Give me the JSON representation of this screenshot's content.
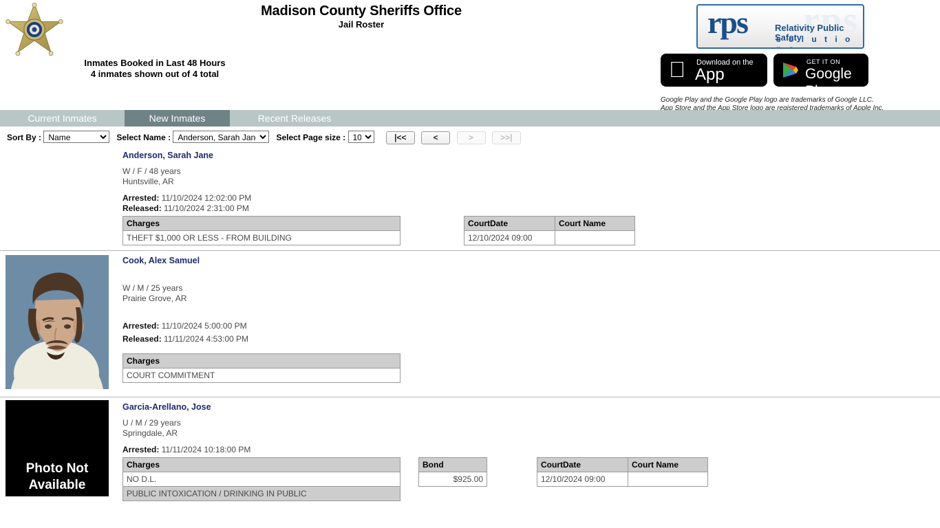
{
  "header": {
    "badge_icon": "sheriff-star-badge-icon",
    "title": "Madison County Sheriffs Office",
    "subtitle": "Jail Roster",
    "booked_heading": "Inmates Booked in Last 48 Hours",
    "booked_count": "4 inmates shown out of 4 total",
    "logo": {
      "mark": "rps",
      "ghost": "rps",
      "line1": "Relativity Public Safety",
      "line2": "s o l u t i o n s"
    },
    "app_store": {
      "small": "Download on the",
      "big": "App Store",
      "icon": "apple-logo-icon"
    },
    "google_play": {
      "small": "GET IT ON",
      "big": "Google Play",
      "icon": "google-play-triangle-icon"
    },
    "trademark_line1": "Google Play and the Google Play logo are trademarks of Google LLC.",
    "trademark_line2": "App Store and the App Store logo are registered trademarks of Apple Inc."
  },
  "tabs": [
    {
      "label": "Current Inmates",
      "active": false
    },
    {
      "label": "New Inmates",
      "active": true
    },
    {
      "label": "Recent Releases",
      "active": false
    }
  ],
  "controls": {
    "sort_by_label": "Sort By :",
    "sort_by_value": "Name",
    "select_name_label": "Select Name :",
    "select_name_value": "Anderson, Sarah Jane",
    "page_size_label": "Select Page size :",
    "page_size_value": "10",
    "pager": {
      "first": "|<<",
      "prev": "<",
      "next": ">",
      "last": ">>|",
      "first_enabled": true,
      "prev_enabled": true,
      "next_enabled": false,
      "last_enabled": false
    }
  },
  "table_headers": {
    "charges": "Charges",
    "bond": "Bond",
    "court_date": "CourtDate",
    "court_name": "Court Name"
  },
  "labels": {
    "arrested": "Arrested:",
    "released": "Released:",
    "photo_not_available_line1": "Photo Not",
    "photo_not_available_line2": "Available"
  },
  "inmates": [
    {
      "name": "Anderson, Sarah Jane",
      "demographics": "W / F / 48 years",
      "location": "Huntsville, AR",
      "arrested": "11/10/2024 12:02:00 PM",
      "released": "11/10/2024 2:31:00 PM",
      "photo": "none",
      "charges": [
        "THEFT $1,000 OR LESS - FROM BUILDING"
      ],
      "bond": null,
      "court": [
        {
          "date": "12/10/2024 09:00",
          "name": ""
        }
      ]
    },
    {
      "name": "Cook, Alex Samuel",
      "demographics": "W / M / 25 years",
      "location": "Prairie Grove, AR",
      "arrested": "11/10/2024 5:00:00 PM",
      "released": "11/11/2024 4:53:00 PM",
      "photo": "mugshot",
      "charges": [
        "COURT COMMITMENT"
      ],
      "bond": null,
      "court": []
    },
    {
      "name": "Garcia-Arellano, Jose",
      "demographics": "U / M / 29 years",
      "location": "Springdale, AR",
      "arrested": "11/11/2024 10:18:00 PM",
      "released": null,
      "photo": "not-available",
      "charges": [
        "NO D.L.",
        "PUBLIC INTOXICATION / DRINKING IN PUBLIC"
      ],
      "bond": "$925.00",
      "court": [
        {
          "date": "12/10/2024 09:00",
          "name": ""
        }
      ]
    }
  ],
  "colors": {
    "tab_bar": "#b9c6c6",
    "tab_active": "#6f8285",
    "name_link": "#1f2a6e",
    "table_header": "#cdcdcd",
    "logo_blue": "#1b4f8a"
  }
}
